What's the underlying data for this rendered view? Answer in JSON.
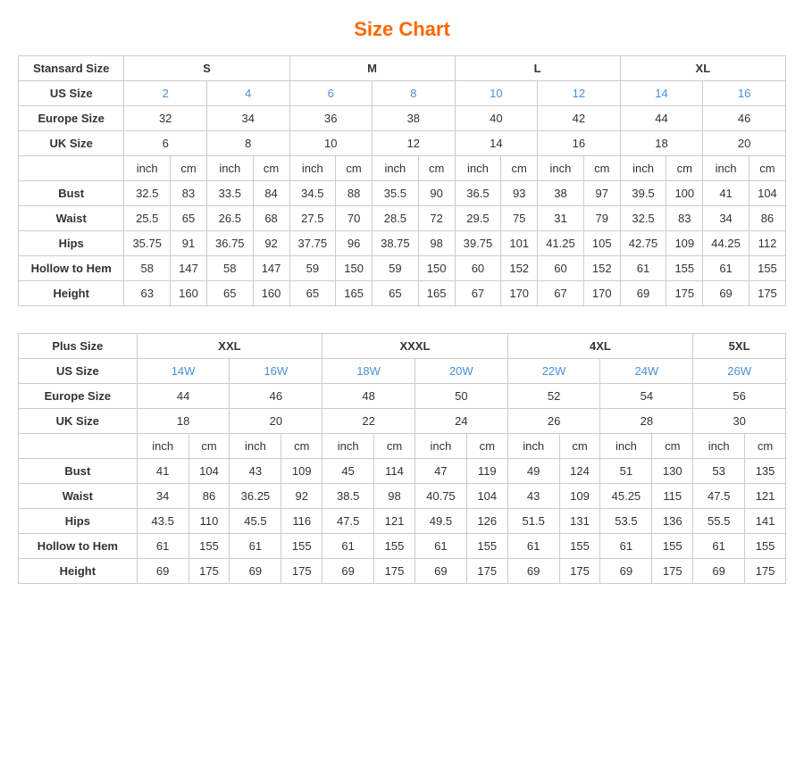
{
  "title": "Size Chart",
  "standard": {
    "section_label": "Stansard Size",
    "col_groups": [
      "S",
      "M",
      "L",
      "XL"
    ],
    "us_sizes": [
      "2",
      "4",
      "6",
      "8",
      "10",
      "12",
      "14",
      "16"
    ],
    "europe_sizes": [
      "32",
      "34",
      "36",
      "38",
      "40",
      "42",
      "44",
      "46"
    ],
    "uk_sizes": [
      "6",
      "8",
      "10",
      "12",
      "14",
      "16",
      "18",
      "20"
    ],
    "measurements": {
      "bust": [
        "32.5",
        "83",
        "33.5",
        "84",
        "34.5",
        "88",
        "35.5",
        "90",
        "36.5",
        "93",
        "38",
        "97",
        "39.5",
        "100",
        "41",
        "104"
      ],
      "waist": [
        "25.5",
        "65",
        "26.5",
        "68",
        "27.5",
        "70",
        "28.5",
        "72",
        "29.5",
        "75",
        "31",
        "79",
        "32.5",
        "83",
        "34",
        "86"
      ],
      "hips": [
        "35.75",
        "91",
        "36.75",
        "92",
        "37.75",
        "96",
        "38.75",
        "98",
        "39.75",
        "101",
        "41.25",
        "105",
        "42.75",
        "109",
        "44.25",
        "112"
      ],
      "hollow_hem": [
        "58",
        "147",
        "58",
        "147",
        "59",
        "150",
        "59",
        "150",
        "60",
        "152",
        "60",
        "152",
        "61",
        "155",
        "61",
        "155"
      ],
      "height": [
        "63",
        "160",
        "65",
        "160",
        "65",
        "165",
        "65",
        "165",
        "67",
        "170",
        "67",
        "170",
        "69",
        "175",
        "69",
        "175"
      ]
    }
  },
  "plus": {
    "section_label": "Plus Size",
    "col_groups": [
      "XXL",
      "XXXL",
      "4XL",
      "5XL"
    ],
    "us_sizes": [
      "14W",
      "16W",
      "18W",
      "20W",
      "22W",
      "24W",
      "26W"
    ],
    "europe_sizes": [
      "44",
      "46",
      "48",
      "50",
      "52",
      "54",
      "56"
    ],
    "uk_sizes": [
      "18",
      "20",
      "22",
      "24",
      "26",
      "28",
      "30"
    ],
    "measurements": {
      "bust": [
        "41",
        "104",
        "43",
        "109",
        "45",
        "114",
        "47",
        "119",
        "49",
        "124",
        "51",
        "130",
        "53",
        "135"
      ],
      "waist": [
        "34",
        "86",
        "36.25",
        "92",
        "38.5",
        "98",
        "40.75",
        "104",
        "43",
        "109",
        "45.25",
        "115",
        "47.5",
        "121"
      ],
      "hips": [
        "43.5",
        "110",
        "45.5",
        "116",
        "47.5",
        "121",
        "49.5",
        "126",
        "51.5",
        "131",
        "53.5",
        "136",
        "55.5",
        "141"
      ],
      "hollow_hem": [
        "61",
        "155",
        "61",
        "155",
        "61",
        "155",
        "61",
        "155",
        "61",
        "155",
        "61",
        "155",
        "61",
        "155"
      ],
      "height": [
        "69",
        "175",
        "69",
        "175",
        "69",
        "175",
        "69",
        "175",
        "69",
        "175",
        "69",
        "175",
        "69",
        "175"
      ]
    }
  },
  "labels": {
    "inch": "inch",
    "cm": "cm",
    "us_size": "US Size",
    "europe_size": "Europe Size",
    "uk_size": "UK Size",
    "bust": "Bust",
    "waist": "Waist",
    "hips": "Hips",
    "hollow_hem": "Hollow to Hem",
    "height": "Height"
  }
}
